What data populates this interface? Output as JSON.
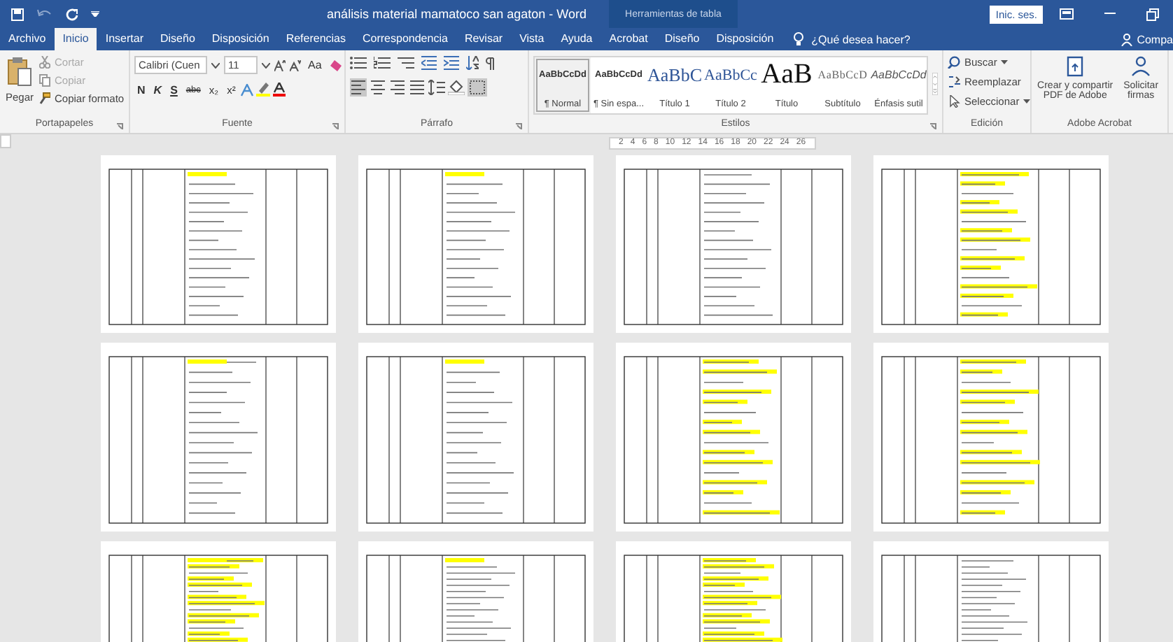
{
  "title_bar": {
    "title": "análisis material mamatoco san agaton  -  Word",
    "context_title": "Herramientas de tabla",
    "sign_in": "Inic. ses."
  },
  "tabs": [
    {
      "label": "Archivo",
      "selected": false
    },
    {
      "label": "Inicio",
      "selected": true
    },
    {
      "label": "Insertar",
      "selected": false
    },
    {
      "label": "Diseño",
      "selected": false
    },
    {
      "label": "Disposición",
      "selected": false
    },
    {
      "label": "Referencias",
      "selected": false
    },
    {
      "label": "Correspondencia",
      "selected": false
    },
    {
      "label": "Revisar",
      "selected": false
    },
    {
      "label": "Vista",
      "selected": false
    },
    {
      "label": "Ayuda",
      "selected": false
    },
    {
      "label": "Acrobat",
      "selected": false
    },
    {
      "label": "Diseño",
      "selected": false
    },
    {
      "label": "Disposición",
      "selected": false
    }
  ],
  "tell_me": "¿Qué desea hacer?",
  "share": "Compa",
  "clipboard": {
    "label": "Portapapeles",
    "paste": "Pegar",
    "items": [
      {
        "label": "Cortar",
        "disabled": true
      },
      {
        "label": "Copiar",
        "disabled": true
      },
      {
        "label": "Copiar formato",
        "disabled": false
      }
    ]
  },
  "font": {
    "label": "Fuente",
    "font_name": "Calibri (Cuen",
    "font_size": "11",
    "change_case": "Aa",
    "format_buttons": [
      "N",
      "K",
      "S",
      "abc",
      "x₂",
      "x²"
    ]
  },
  "paragraph": {
    "label": "Párrafo",
    "alignments": [
      {
        "selected": true
      },
      {
        "selected": false
      },
      {
        "selected": false
      },
      {
        "selected": false
      }
    ]
  },
  "styles": {
    "label": "Estilos",
    "items": [
      {
        "preview": "AaBbCcDd",
        "name": "¶ Normal",
        "kind": "normal",
        "selected": true
      },
      {
        "preview": "AaBbCcDd",
        "name": "¶ Sin espa...",
        "kind": "normal",
        "selected": false
      },
      {
        "preview": "AaBbC",
        "name": "Título 1",
        "kind": "heading1",
        "selected": false
      },
      {
        "preview": "AaBbCc",
        "name": "Título 2",
        "kind": "heading2",
        "selected": false
      },
      {
        "preview": "AaB",
        "name": "Título",
        "kind": "title",
        "selected": false
      },
      {
        "preview": "AaBbCcD",
        "name": "Subtítulo",
        "kind": "subtitle",
        "selected": false
      },
      {
        "preview": "AaBbCcDd",
        "name": "Énfasis sutil",
        "kind": "emphasis",
        "selected": false
      }
    ]
  },
  "editing": {
    "label": "Edición",
    "items": [
      {
        "label": "Buscar",
        "kind": "find"
      },
      {
        "label": "Reemplazar",
        "kind": "replace"
      },
      {
        "label": "Seleccionar",
        "kind": "select"
      }
    ]
  },
  "acrobat": {
    "label": "Adobe Acrobat",
    "items": [
      {
        "label": "Crear y compartir PDF de Adobe",
        "kind": "pdf"
      },
      {
        "label": "Solicitar firmas",
        "kind": "sign"
      }
    ]
  },
  "ruler": [
    "2",
    "4",
    "6",
    "8",
    "10",
    "12",
    "14",
    "16",
    "18",
    "20",
    "22",
    "24",
    "26"
  ]
}
